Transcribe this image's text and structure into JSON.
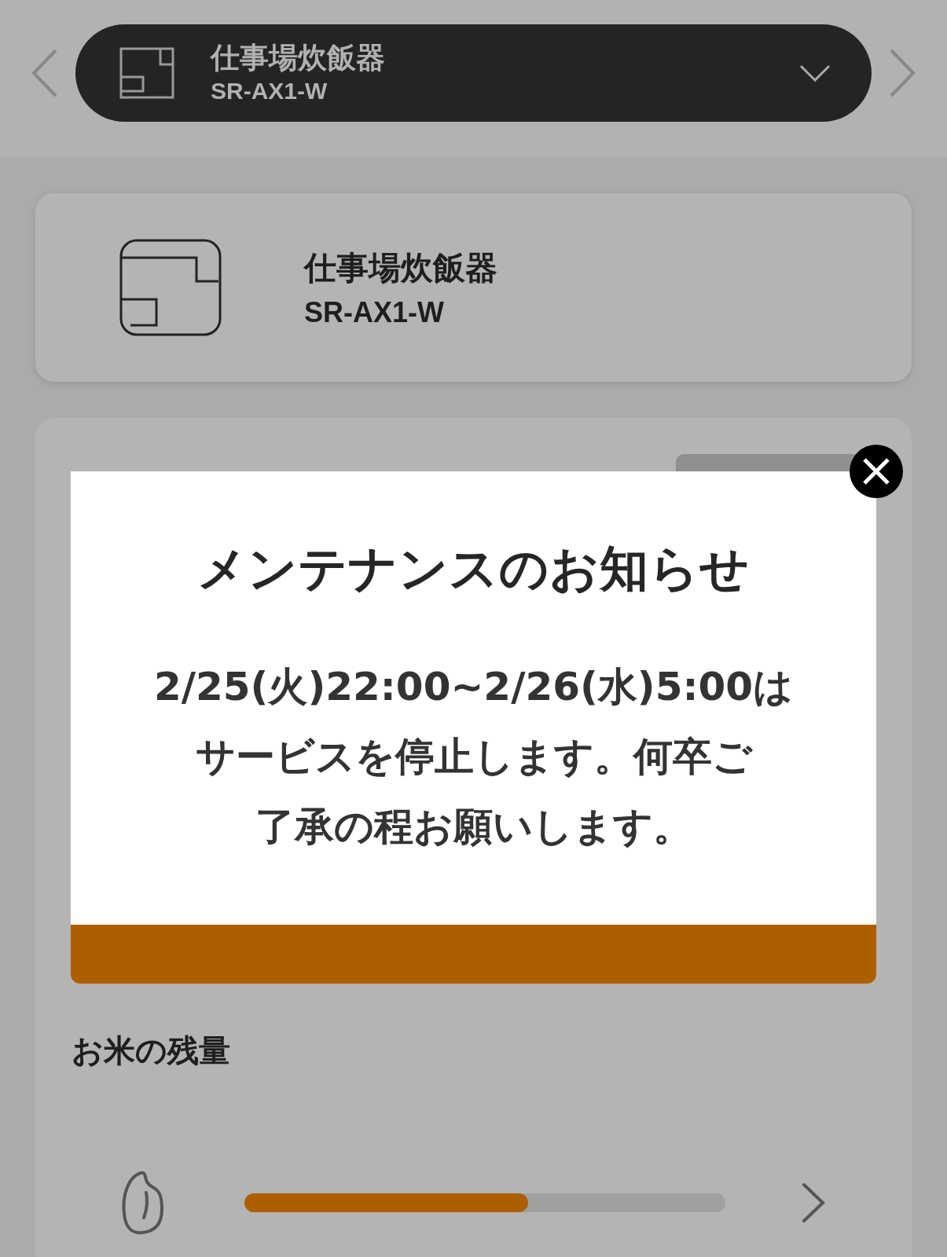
{
  "device_selector": {
    "name": "仕事場炊飯器",
    "model": "SR-AX1-W"
  },
  "device_card": {
    "name": "仕事場炊飯器",
    "model": "SR-AX1-W"
  },
  "status_card": {
    "rice_remaining": {
      "title": "お米の残量",
      "level": 0.59
    }
  },
  "modal": {
    "title": "メンテナンスのお知らせ",
    "lines": [
      "2/25(火)22:00~2/26(水)5:00は",
      "サービスを停止します。何卒ご",
      "了承の程お願いします。"
    ]
  }
}
